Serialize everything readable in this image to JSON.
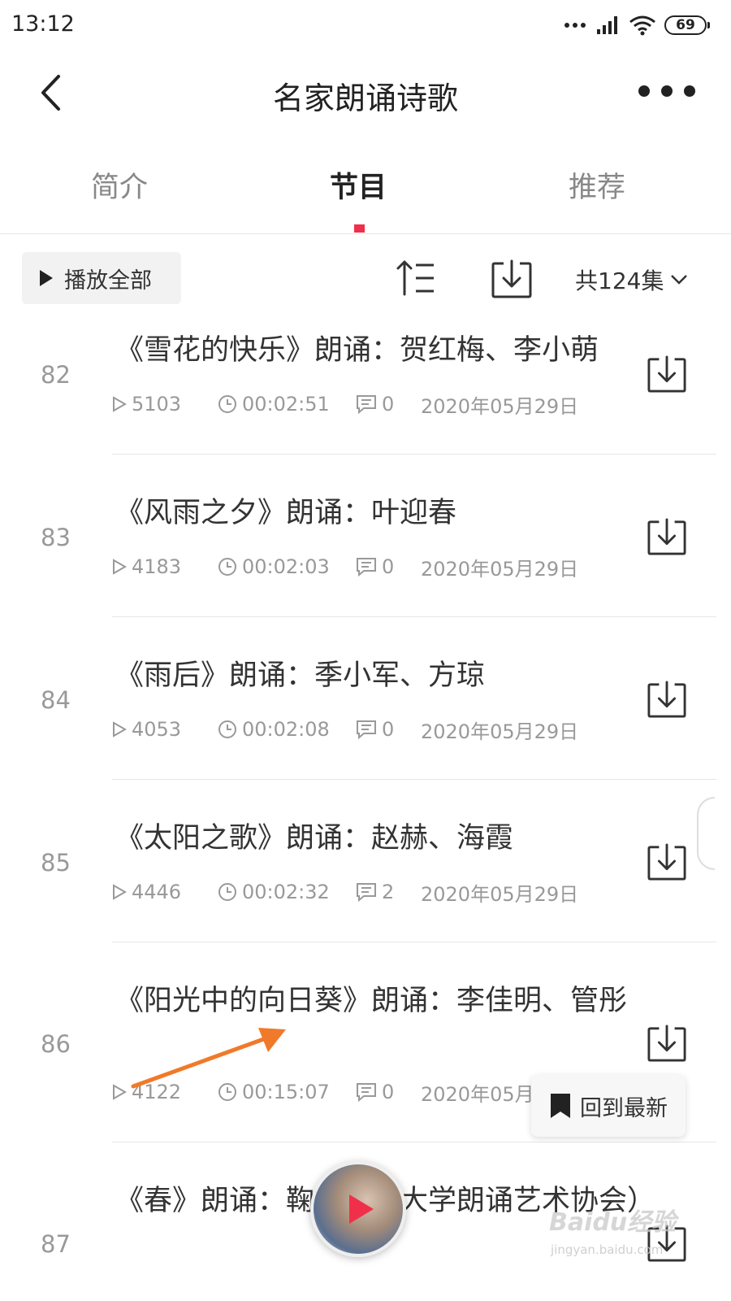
{
  "status_bar": {
    "time": "13:12",
    "battery": "69"
  },
  "nav": {
    "title": "名家朗诵诗歌"
  },
  "tabs": [
    {
      "label": "简介"
    },
    {
      "label": "节目"
    },
    {
      "label": "推荐"
    }
  ],
  "toolbar": {
    "play_all": "播放全部",
    "episode_count": "共124集"
  },
  "episodes": [
    {
      "num": "82",
      "title": "《雪花的快乐》朗诵：贺红梅、李小萌",
      "plays": "5103",
      "duration": "00:02:51",
      "comments": "0",
      "date": "2020年05月29日"
    },
    {
      "num": "83",
      "title": "《风雨之夕》朗诵：叶迎春",
      "plays": "4183",
      "duration": "00:02:03",
      "comments": "0",
      "date": "2020年05月29日"
    },
    {
      "num": "84",
      "title": "《雨后》朗诵：季小军、方琼",
      "plays": "4053",
      "duration": "00:02:08",
      "comments": "0",
      "date": "2020年05月29日"
    },
    {
      "num": "85",
      "title": "《太阳之歌》朗诵：赵赫、海霞",
      "plays": "4446",
      "duration": "00:02:32",
      "comments": "2",
      "date": "2020年05月29日"
    },
    {
      "num": "86",
      "title": "《阳光中的向日葵》朗诵：李佳明、管彤",
      "plays": "4122",
      "duration": "00:15:07",
      "comments": "0",
      "date": "2020年05月29日"
    },
    {
      "num": "87",
      "title": "《春》朗诵：鞠　　京大学朗诵艺术协会）"
    }
  ],
  "back_to_latest": "回到最新",
  "watermark": {
    "brand": "Baidu经验",
    "url": "jingyan.baidu.com"
  },
  "colors": {
    "accent": "#f0304a",
    "annotation_arrow": "#f07a2a"
  }
}
